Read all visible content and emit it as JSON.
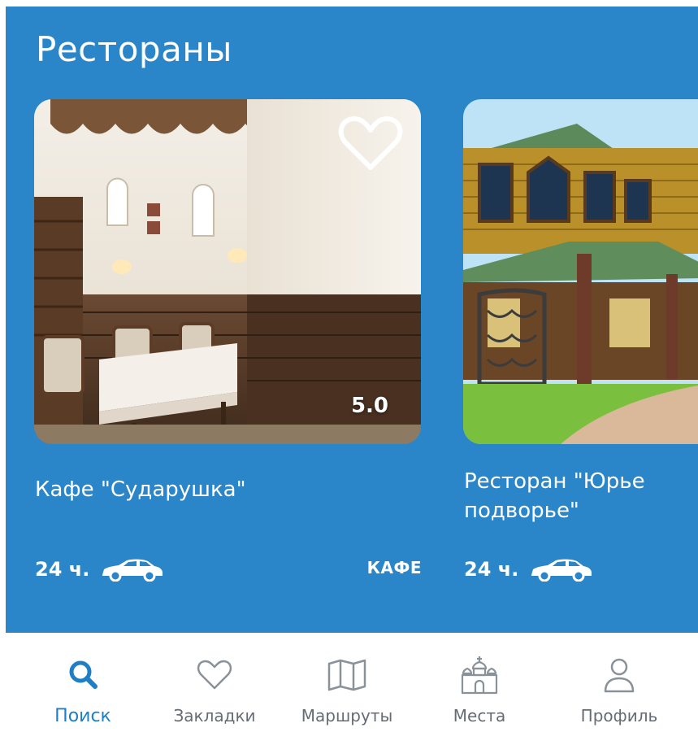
{
  "section": {
    "title": "Рестораны"
  },
  "cards": [
    {
      "name": "Кафе \"Сударушка\"",
      "rating": "5.0",
      "hours": "24 ч.",
      "category": "КАФЕ",
      "favorite_icon": "heart-outline-icon",
      "transport_icon": "car-icon"
    },
    {
      "name": "Ресторан \"Юрье\nподворье\"",
      "hours": "24 ч.",
      "transport_icon": "car-icon"
    }
  ],
  "nav": {
    "items": [
      {
        "label": "Поиск",
        "icon": "search-icon",
        "active": true
      },
      {
        "label": "Закладки",
        "icon": "heart-icon"
      },
      {
        "label": "Маршруты",
        "icon": "map-icon"
      },
      {
        "label": "Места",
        "icon": "church-icon"
      },
      {
        "label": "Профиль",
        "icon": "user-icon"
      }
    ]
  },
  "colors": {
    "primary_blue": "#2a86c8",
    "active_nav": "#1f7fc4",
    "inactive_nav": "#666c72",
    "white": "#ffffff"
  }
}
